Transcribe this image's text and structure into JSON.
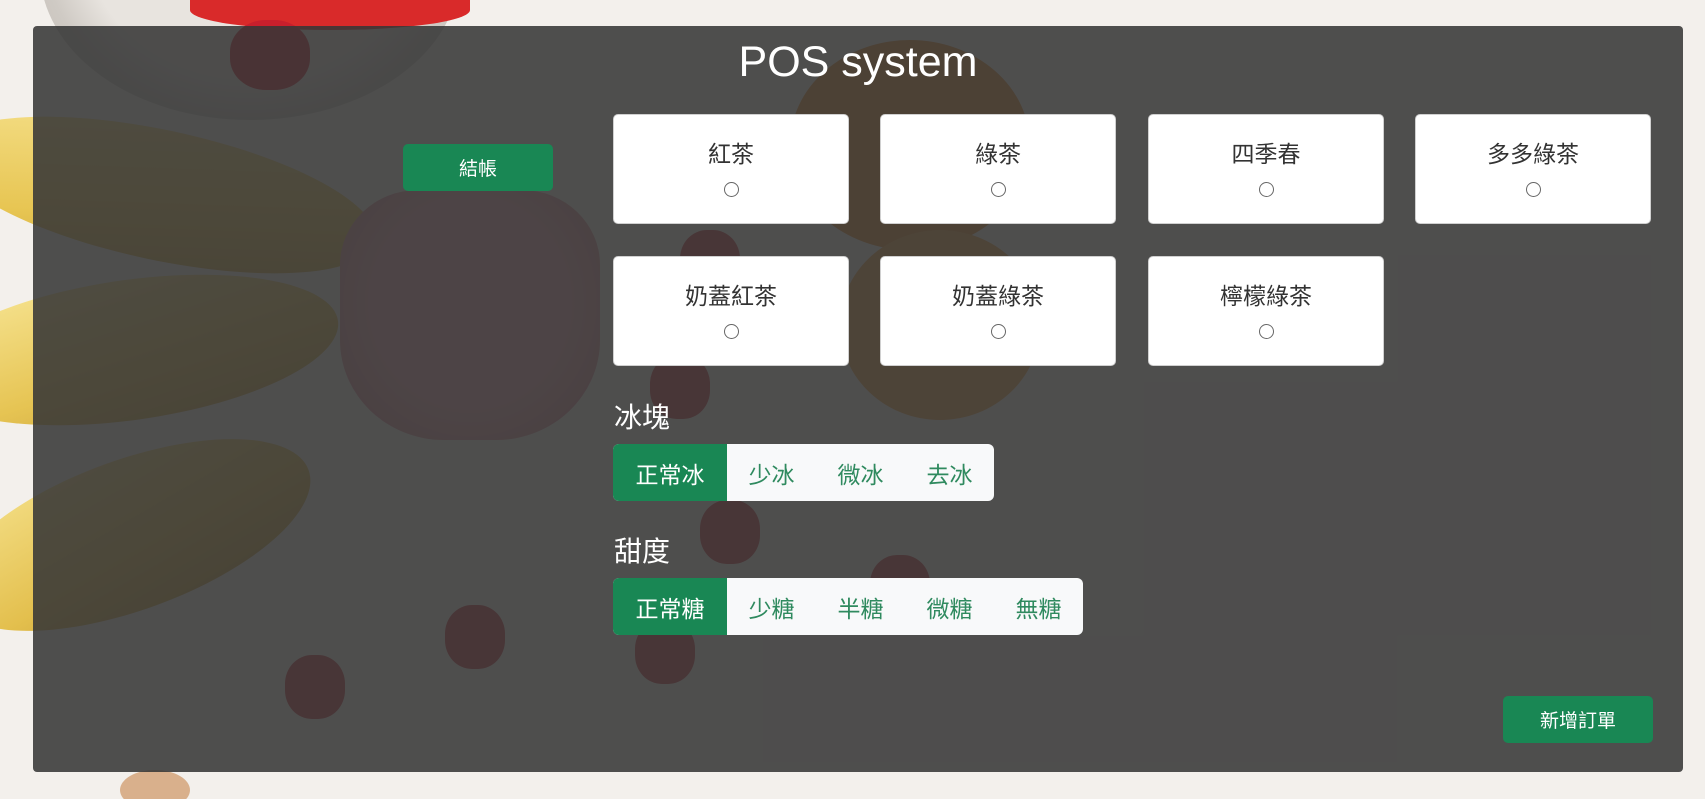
{
  "app": {
    "title": "POS system"
  },
  "actions": {
    "checkout_label": "結帳",
    "new_order_label": "新增訂單"
  },
  "drinks": [
    {
      "name": "紅茶",
      "selected": false
    },
    {
      "name": "綠茶",
      "selected": false
    },
    {
      "name": "四季春",
      "selected": false
    },
    {
      "name": "多多綠茶",
      "selected": false
    },
    {
      "name": "奶蓋紅茶",
      "selected": false
    },
    {
      "name": "奶蓋綠茶",
      "selected": false
    },
    {
      "name": "檸檬綠茶",
      "selected": false
    }
  ],
  "ice": {
    "label": "冰塊",
    "options": [
      "正常冰",
      "少冰",
      "微冰",
      "去冰"
    ],
    "selected": "正常冰"
  },
  "sugar": {
    "label": "甜度",
    "options": [
      "正常糖",
      "少糖",
      "半糖",
      "微糖",
      "無糖"
    ],
    "selected": "正常糖"
  },
  "colors": {
    "accent": "#198754",
    "panel": "#373737",
    "option_text": "#2f8a5f"
  }
}
